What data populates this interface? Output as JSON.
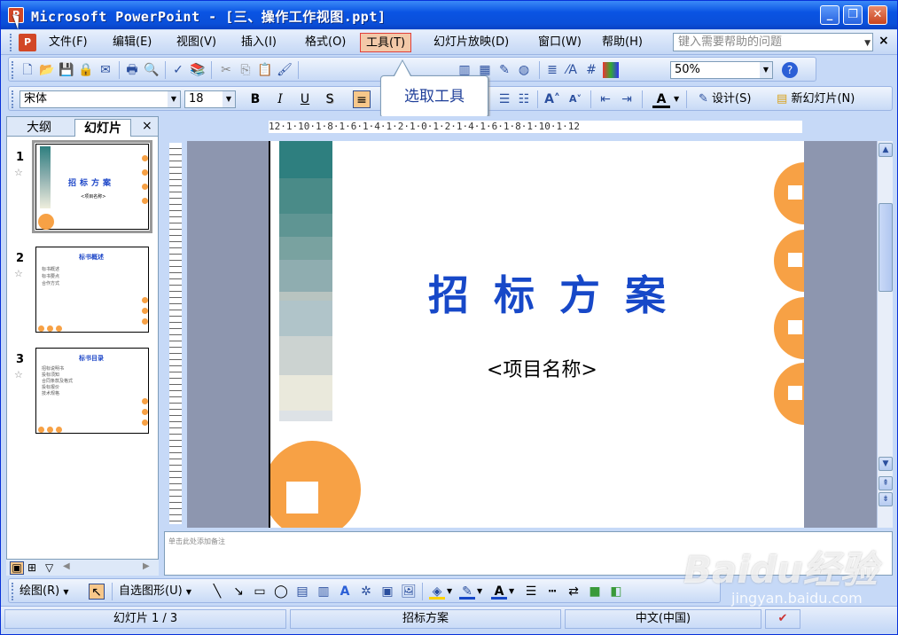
{
  "window": {
    "title": "Microsoft PowerPoint - [三、操作工作视图.ppt]",
    "app_icon": "powerpoint-icon",
    "controls": {
      "minimize": "_",
      "restore": "❐",
      "close": "✕"
    }
  },
  "menu": {
    "items": [
      {
        "label": "文件(F)"
      },
      {
        "label": "编辑(E)"
      },
      {
        "label": "视图(V)"
      },
      {
        "label": "插入(I)"
      },
      {
        "label": "格式(O)"
      },
      {
        "label": "工具(T)"
      },
      {
        "label": "幻灯片放映(D)"
      },
      {
        "label": "窗口(W)"
      },
      {
        "label": "帮助(H)"
      }
    ],
    "active_index": 5,
    "help_placeholder": "键入需要帮助的问题",
    "close": "×"
  },
  "standard_toolbar": {
    "zoom": "50%",
    "help": "?"
  },
  "formatting_toolbar": {
    "font": "宋体",
    "size": "18",
    "bold": "B",
    "italic": "I",
    "underline": "U",
    "shadow": "S",
    "font_color": "A",
    "design_label": "设计(S)",
    "new_slide_label": "新幻灯片(N)"
  },
  "callout": {
    "text": "选取工具"
  },
  "slides_pane": {
    "tab_outline": "大纲",
    "tab_slides": "幻灯片",
    "close": "×",
    "slides": [
      {
        "number": "1",
        "title": "招标方案",
        "sub": "<项目名称>"
      },
      {
        "number": "2",
        "title": "标书概述",
        "bullets": [
          "标书概述",
          "标书要点",
          "合作方式"
        ]
      },
      {
        "number": "3",
        "title": "标书目录",
        "bullets": [
          "招标说明书",
          "投标须知",
          "合同条款及格式",
          "投标报价",
          "技术规格"
        ]
      }
    ]
  },
  "ruler": {
    "horizontal": "12·1·10·1·8·1·6·1·4·1·2·1·0·1·2·1·4·1·6·1·8·1·10·1·12"
  },
  "slide": {
    "title": "招标方案",
    "subtitle": "<项目名称>"
  },
  "notes": {
    "placeholder": "单击此处添加备注"
  },
  "drawing_toolbar": {
    "draw_label": "绘图(R)",
    "autoshapes_label": "自选图形(U)"
  },
  "status": {
    "slide_pos": "幻灯片 1 / 3",
    "template": "招标方案",
    "language": "中文(中国)"
  },
  "watermark": {
    "text": "Baidu经验",
    "url": "jingyan.baidu.com"
  },
  "colors": {
    "title_blue": "#1748c8",
    "accent_orange": "#f7a145",
    "teal_dark": "#2e7f7f",
    "xp_blue": "#0a54e3"
  }
}
